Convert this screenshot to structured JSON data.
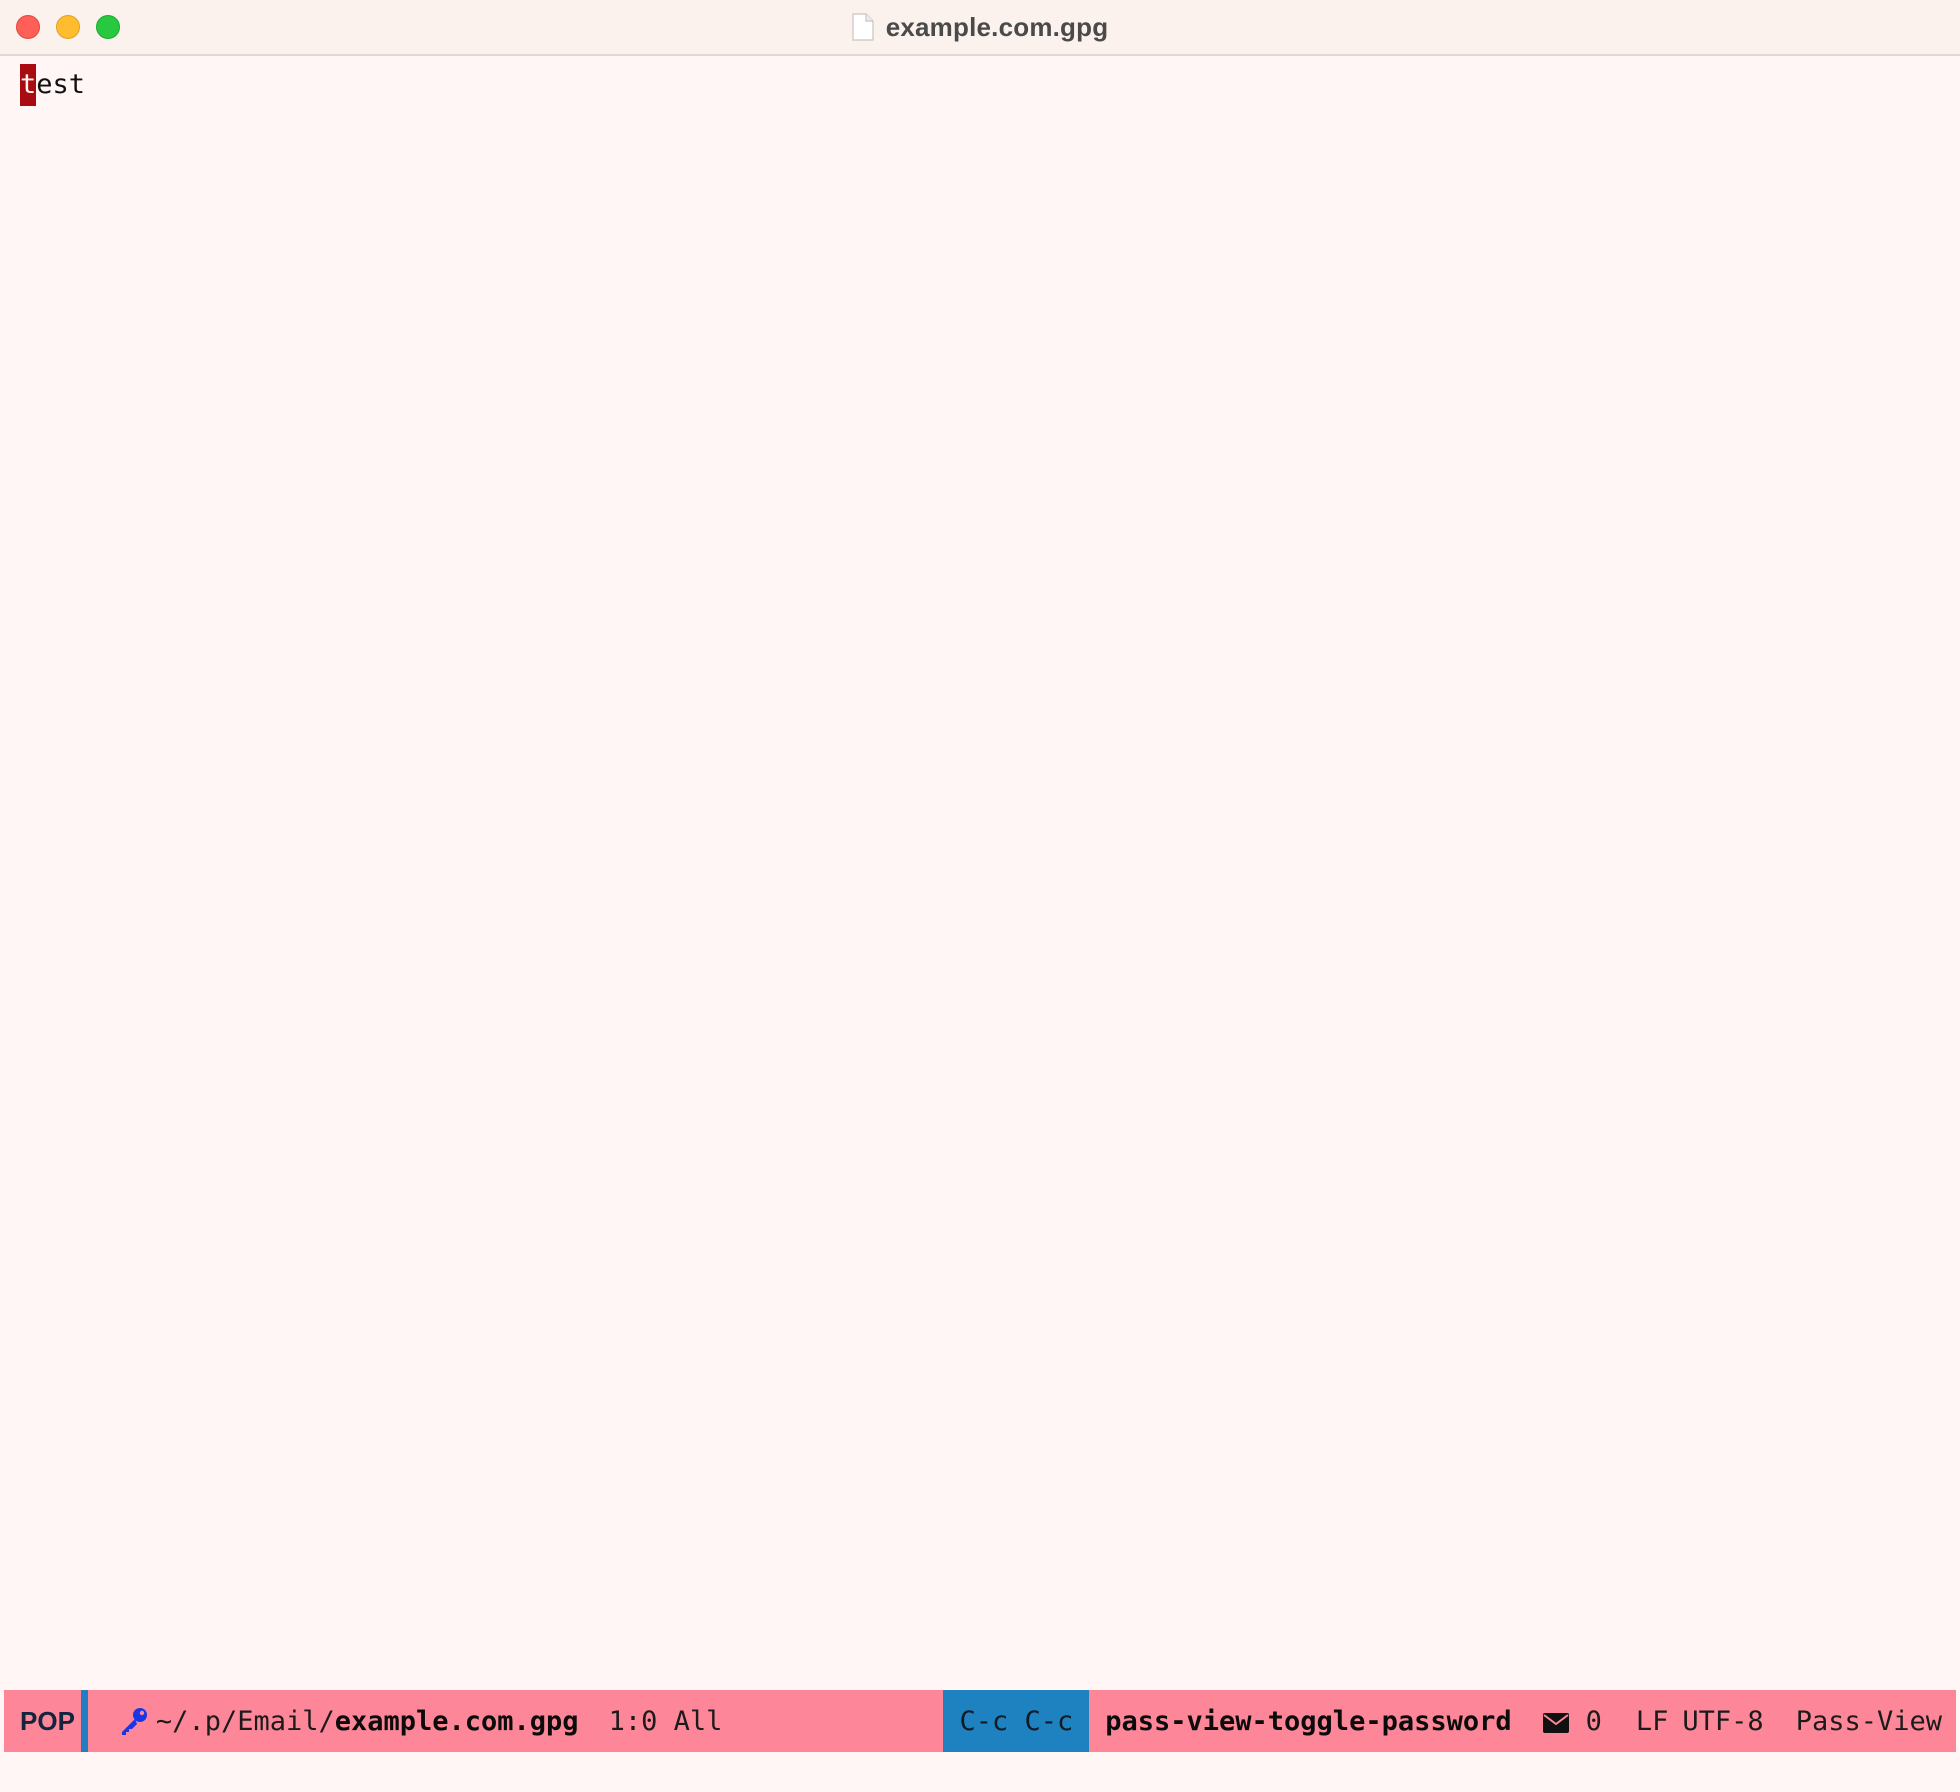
{
  "window": {
    "title": "example.com.gpg"
  },
  "buffer": {
    "cursor_char": "t",
    "rest_text": "est"
  },
  "modeline": {
    "state": "POP",
    "path_prefix": "~/.p/Email/",
    "file_name": "example.com.gpg",
    "position": "1:0 All",
    "key_hint": "C-c C-c",
    "command": "pass-view-toggle-password",
    "mail_count": "0",
    "eol": "LF",
    "encoding": "UTF-8",
    "major_mode": "Pass-View",
    "icons": {
      "key": "key-icon",
      "mail": "mail-icon"
    }
  },
  "colors": {
    "background": "#fff6f5",
    "modeline": "#fd8799",
    "accent": "#1f82c0",
    "cursor": "#a80b10"
  }
}
